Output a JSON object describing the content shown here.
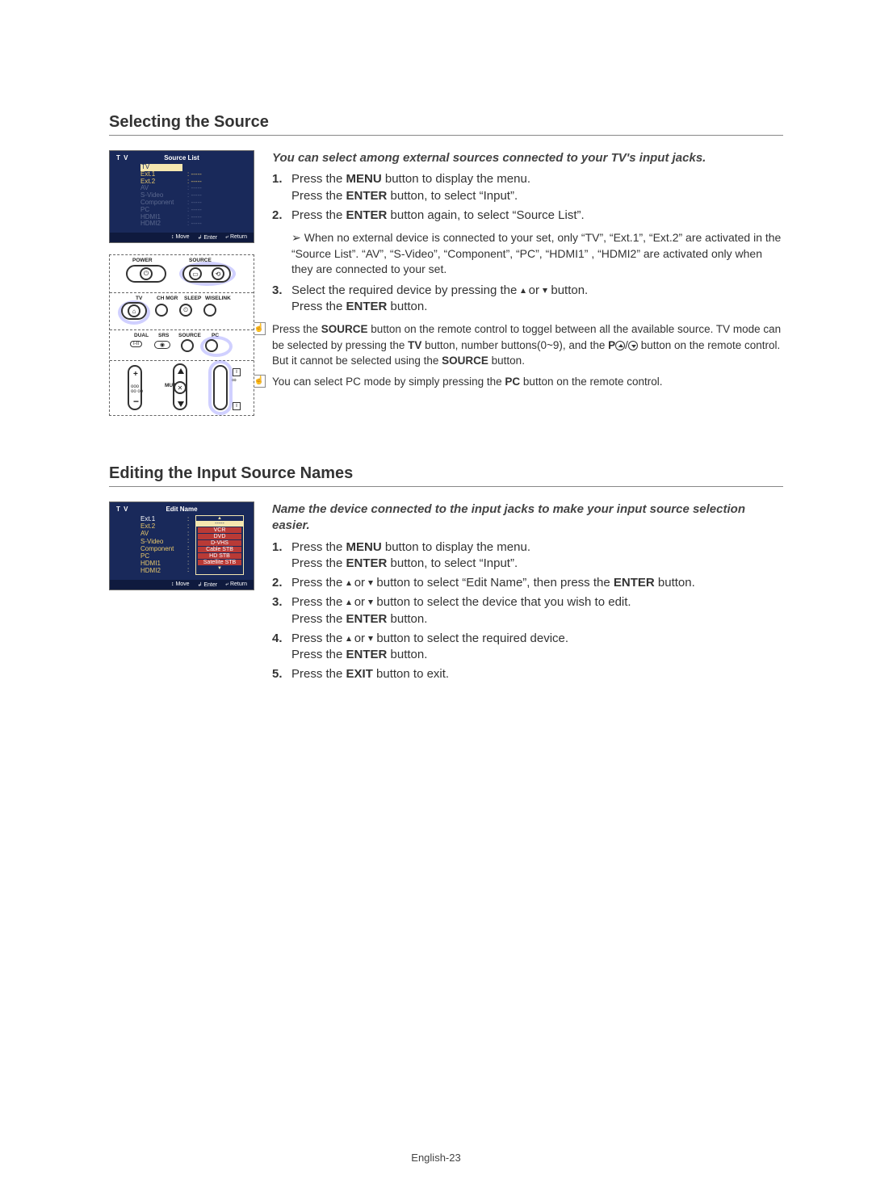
{
  "section1": {
    "title": "Selecting the Source",
    "intro": "You can select among external sources connected to your TV's input jacks.",
    "steps": [
      {
        "num": "1.",
        "pre": "Press the ",
        "bold1": "MENU",
        "mid": " button to display the menu.\nPress the ",
        "bold2": "ENTER",
        "post": " button, to select “Input”."
      },
      {
        "num": "2.",
        "pre": "Press the ",
        "bold1": "ENTER",
        "mid": " button again, to select “Source List”.",
        "bold2": "",
        "post": ""
      },
      {
        "num": "3.",
        "pre": "Select the required device by pressing the ",
        "bold1": "",
        "mid": "",
        "bold2": "",
        "post": " button.\nPress the ",
        "tail_bold": "ENTER",
        "tail": " button."
      }
    ],
    "subnote_arrow": "➢",
    "subnote": "When no external device is connected to your set, only “TV”, “Ext.1”, “Ext.2” are activated in the “Source List”. “AV”, “S-Video”, “Component”, “PC”, “HDMI1” , “HDMI2” are activated only when they are connected to your set.",
    "step3_mid_a": " or ",
    "hint1_a": "Press the ",
    "hint1_b": "SOURCE",
    "hint1_c": " button on the remote control to toggel between all the available source. TV mode can be selected by pressing the ",
    "hint1_d": "TV",
    "hint1_e": " button, number buttons(0~9), and the ",
    "hint1_f": "P",
    "hint1_g": " button on the remote control. But it cannot be selected using the ",
    "hint1_h": "SOURCE",
    "hint1_i": " button.",
    "hint2_a": "You can select PC mode by simply pressing the ",
    "hint2_b": "PC",
    "hint2_c": " button on the remote control."
  },
  "osd1": {
    "tv": "T V",
    "title": "Source List",
    "rows": [
      {
        "label": "TV",
        "val": "",
        "cls": "highlight"
      },
      {
        "label": "Ext.1",
        "val": ": -----",
        "cls": ""
      },
      {
        "label": "Ext.2",
        "val": ": -----",
        "cls": ""
      },
      {
        "label": "AV",
        "val": ": -----",
        "cls": "dim"
      },
      {
        "label": "S-Video",
        "val": ": -----",
        "cls": "dim"
      },
      {
        "label": "Component",
        "val": ": -----",
        "cls": "dim"
      },
      {
        "label": "PC",
        "val": ": -----",
        "cls": "dim"
      },
      {
        "label": "HDMI1",
        "val": ": -----",
        "cls": "dim"
      },
      {
        "label": "HDMI2",
        "val": ": -----",
        "cls": "dim"
      }
    ],
    "foot": [
      "↕ Move",
      "↲ Enter",
      "⤶ Return"
    ]
  },
  "remote": {
    "power": "POWER",
    "source": "SOURCE",
    "tv": "TV",
    "chmgr": "CH MGR",
    "sleep": "SLEEP",
    "wiselink": "WISELINK",
    "dual": "DUAL",
    "srs": "SRS",
    "r_source": "SOURCE",
    "pc": "PC",
    "i_ii": "I-II",
    "mute": "MUTE"
  },
  "section2": {
    "title": "Editing the Input Source Names",
    "intro": "Name the device connected to the input jacks to make your input source selection easier.",
    "steps": {
      "s1": {
        "num": "1.",
        "a": "Press the ",
        "b": "MENU",
        "c": " button to display the menu.\nPress the ",
        "d": "ENTER",
        "e": " button, to select “Input”."
      },
      "s2": {
        "num": "2.",
        "a": "Press the ",
        "c": " or ",
        "e": " button to select “Edit Name”, then press the ",
        "f": "ENTER",
        "g": " button."
      },
      "s3": {
        "num": "3.",
        "a": "Press the ",
        "c": " or ",
        "e": " button to select the device that you wish to edit.\nPress the ",
        "f": "ENTER",
        "g": "  button."
      },
      "s4": {
        "num": "4.",
        "a": "Press the ",
        "c": " or ",
        "e": " button to select the required device.\nPress the ",
        "f": "ENTER",
        "g": " button."
      },
      "s5": {
        "num": "5.",
        "a": "Press the ",
        "b": "EXIT",
        "c": " button to exit."
      }
    }
  },
  "osd2": {
    "tv": "T V",
    "title": "Edit Name",
    "labels": [
      {
        "t": "Ext.1",
        "cls": "hl"
      },
      {
        "t": "Ext.2",
        "cls": ""
      },
      {
        "t": "AV",
        "cls": ""
      },
      {
        "t": "S-Video",
        "cls": ""
      },
      {
        "t": "Component",
        "cls": ""
      },
      {
        "t": "PC",
        "cls": ""
      },
      {
        "t": "HDMI1",
        "cls": ""
      },
      {
        "t": "HDMI2",
        "cls": ""
      }
    ],
    "popup_sel": "-----",
    "popup_opts": [
      "VCR",
      "DVD",
      "D-VHS",
      "Cable STB",
      "HD STB",
      "Satellite STB"
    ],
    "foot": [
      "↕ Move",
      "↲ Enter",
      "⤶ Return"
    ]
  },
  "page_num": "English-23"
}
